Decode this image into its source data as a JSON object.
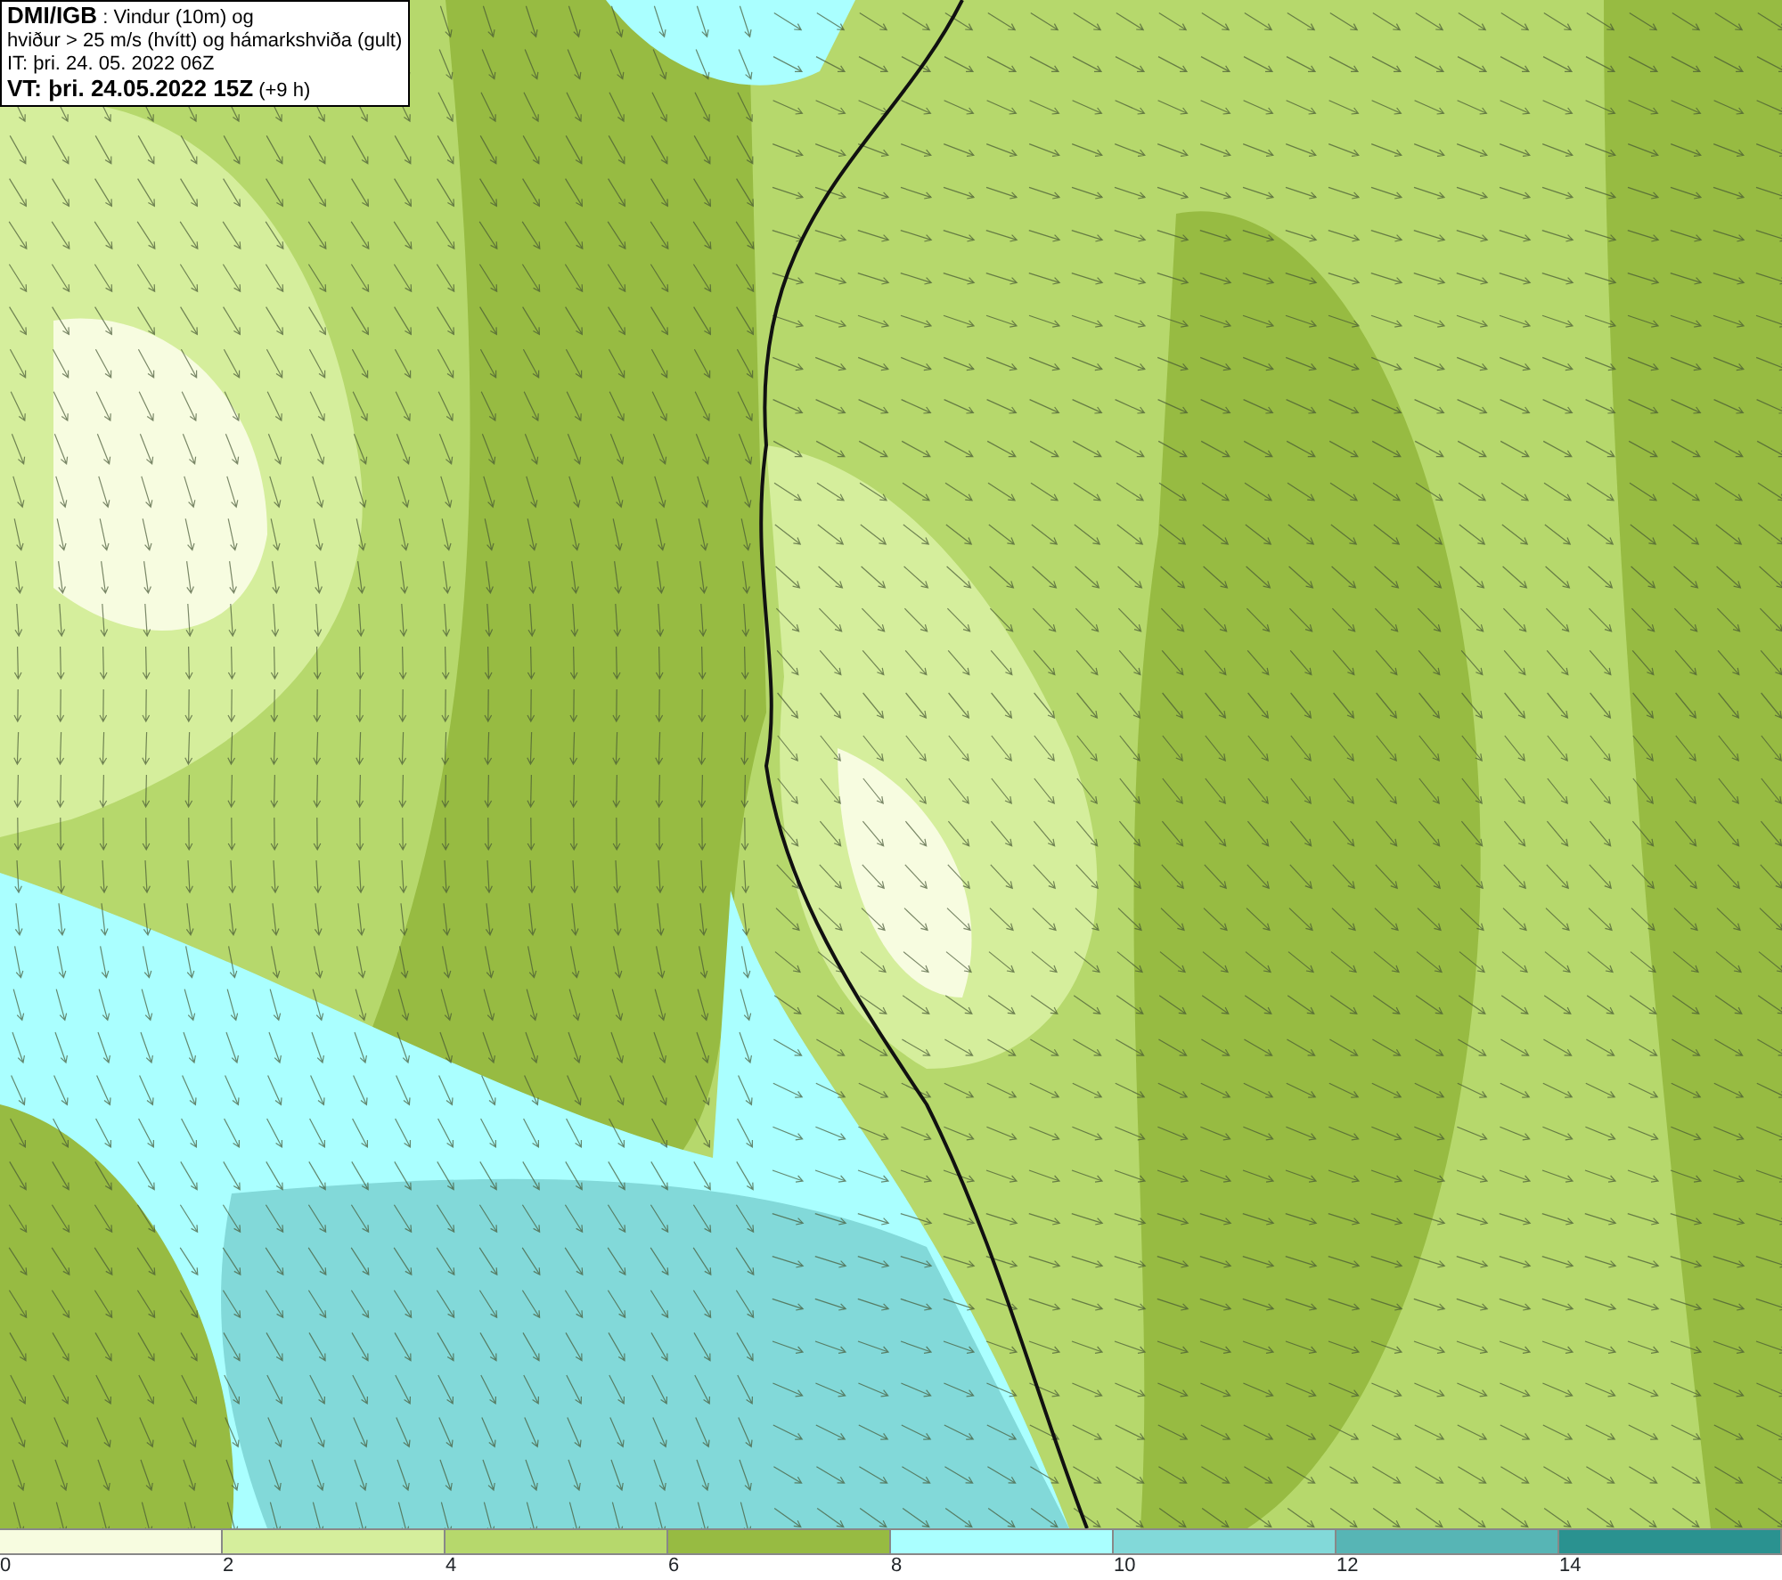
{
  "title_box": {
    "lines": [
      "**DMI/IGB** : Vindur (10m) og",
      "hviður > 25 m/s (hvítt) og hámarkshviða (gult)",
      "IT: þri. 24. 05. 2022 06Z",
      "**VT: þri. 24.05.2022 15Z** (+9 h)"
    ]
  },
  "legend": {
    "bins": [
      {
        "color": "#f7fce0"
      },
      {
        "color": "#d5ee9c"
      },
      {
        "color": "#b6d86c"
      },
      {
        "color": "#97bb42"
      },
      {
        "color": "#aaffff"
      },
      {
        "color": "#82d9d9"
      },
      {
        "color": "#57b5b5"
      },
      {
        "color": "#2a9290"
      }
    ],
    "ticks": [
      "0",
      "2",
      "4",
      "6",
      "8",
      "10",
      "12",
      "14"
    ]
  }
}
